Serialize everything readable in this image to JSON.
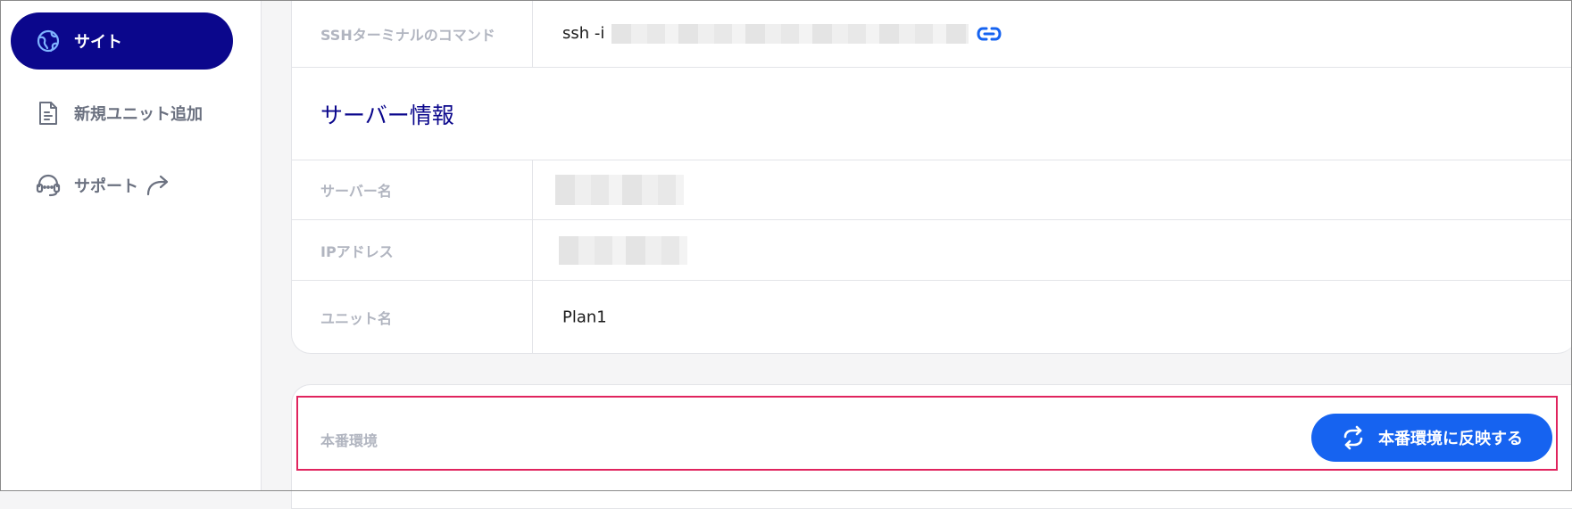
{
  "sidebar": {
    "items": [
      {
        "label": "サイト",
        "icon": "globe-icon",
        "active": true
      },
      {
        "label": "新規ユニット追加",
        "icon": "document-icon",
        "active": false
      },
      {
        "label": "サポート",
        "icon": "headset-icon",
        "active": false,
        "external": true
      }
    ]
  },
  "main": {
    "ssh": {
      "label": "SSHターミナルのコマンド",
      "value_prefix": "ssh -i",
      "link_icon": "link-icon"
    },
    "server_info": {
      "title": "サーバー情報",
      "rows": [
        {
          "label": "サーバー名"
        },
        {
          "label": "IPアドレス"
        },
        {
          "label": "ユニット名",
          "value": "Plan1"
        }
      ]
    },
    "production": {
      "label": "本番環境",
      "deploy_button": "本番環境に反映する",
      "deploy_icon": "refresh-icon"
    }
  },
  "colors": {
    "accent_navy": "#0b078c",
    "button_blue": "#1663f0",
    "highlight_red": "#e0245e",
    "label_gray": "#b1b5c0"
  }
}
